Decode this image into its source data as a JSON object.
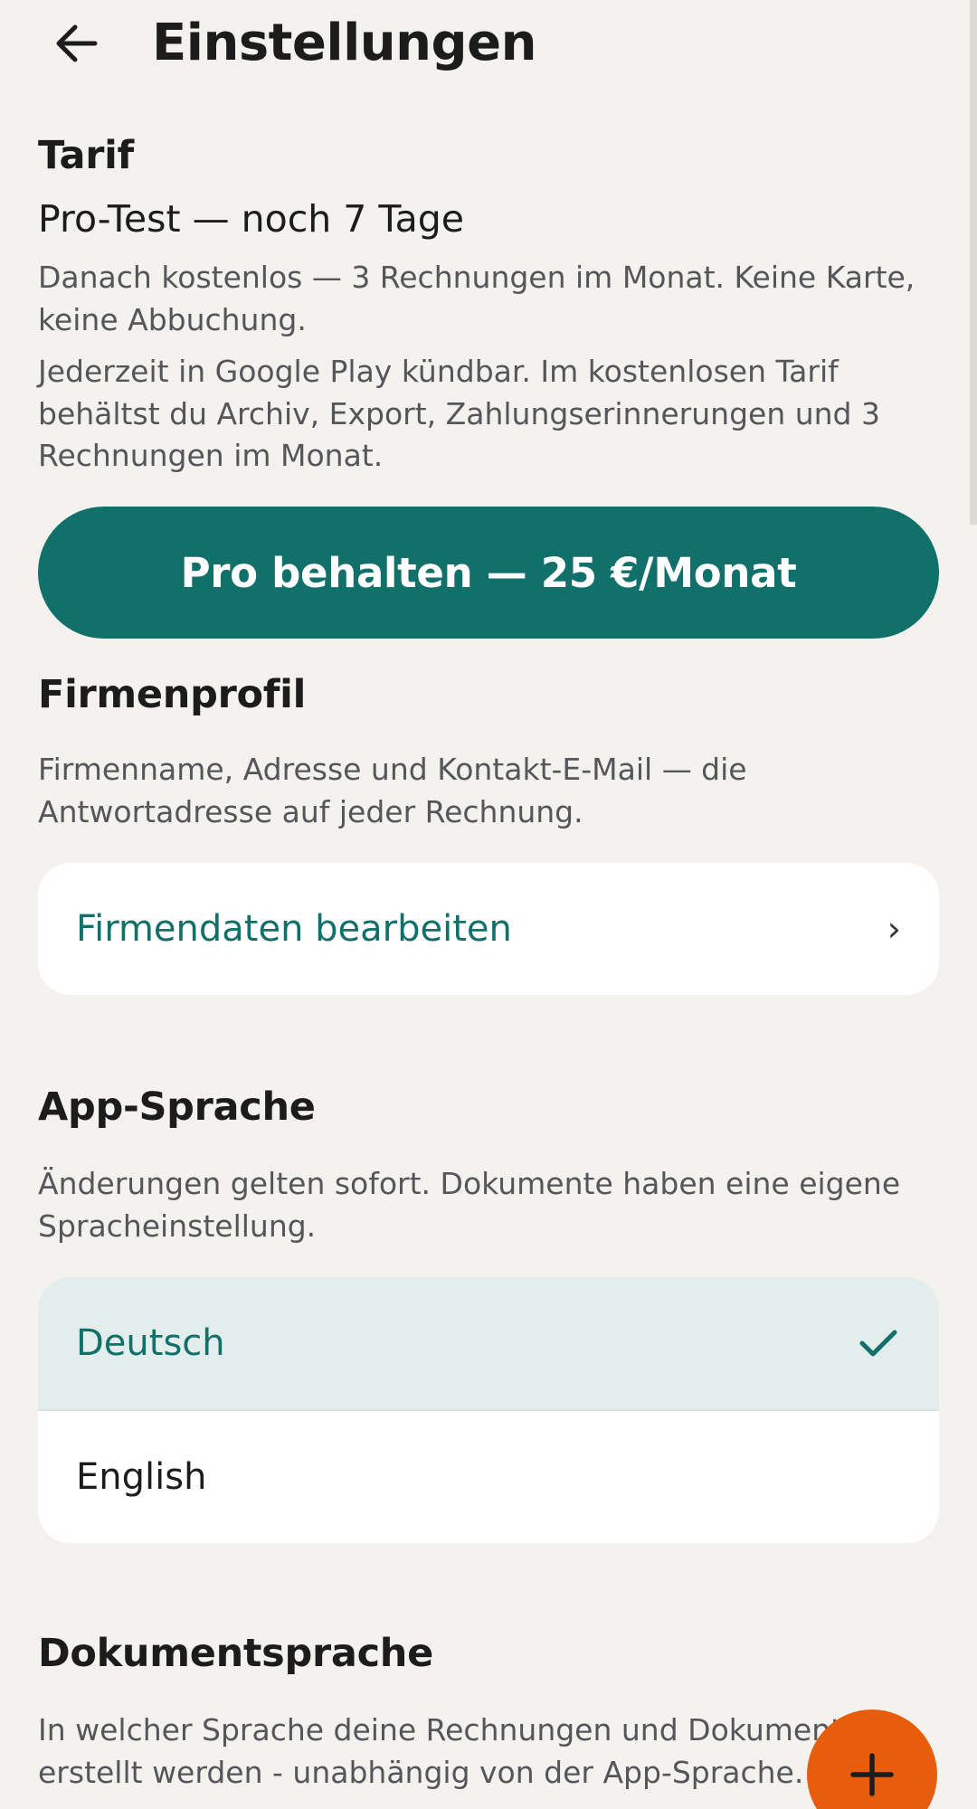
{
  "header": {
    "title": "Einstellungen",
    "back_icon": "arrow-left-icon"
  },
  "tariff": {
    "heading": "Tarif",
    "status": "Pro-Test — noch 7 Tage",
    "note1": "Danach kostenlos — 3 Rechnungen im Monat. Keine Karte, keine Abbuchung.",
    "note2": "Jederzeit in Google Play kündbar. Im kostenlosen Tarif behältst du Archiv, Export, Zahlungserinnerungen und 3 Rechnungen im Monat.",
    "cta_label": "Pro behalten — 25 €/Monat"
  },
  "company": {
    "heading": "Firmenprofil",
    "description": "Firmenname, Adresse und Kontakt-E-Mail — die Antwortadresse auf jeder Rechnung.",
    "edit_label": "Firmendaten bearbeiten",
    "chevron": "›"
  },
  "app_language": {
    "heading": "App-Sprache",
    "description": "Änderungen gelten sofort. Dokumente haben eine eigene Spracheinstellung.",
    "options": [
      {
        "label": "Deutsch",
        "selected": true
      },
      {
        "label": "English",
        "selected": false
      }
    ]
  },
  "document_language": {
    "heading": "Dokumentsprache",
    "description": "In welcher Sprache deine Rechnungen und Dokumente erstellt werden - unabhängig von der App-Sprache."
  },
  "fab": {
    "icon": "plus-icon"
  },
  "colors": {
    "accent": "#12706a",
    "background": "#f3f2ef",
    "fab": "#e85d0c",
    "selected_row": "#e3eeec"
  }
}
